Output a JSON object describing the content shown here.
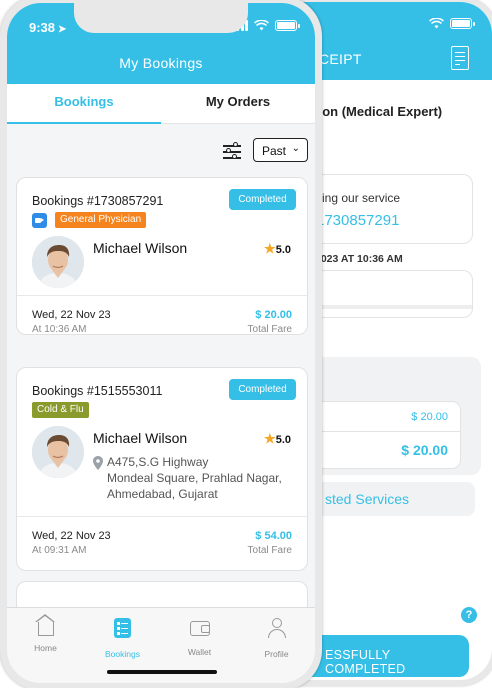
{
  "back_screen": {
    "title_fragment": "CEIPT",
    "doctor_fragment": "son (Medical Expert)",
    "thanks_fragment": "sing our service",
    "booking_id_fragment": "1730857291",
    "datetime_fragment": "2023 AT 10:36 AM",
    "amount_row": "$ 20.00",
    "amount_total": "$ 20.00",
    "services_fragment": "sted Services",
    "help_glyph": "?",
    "complete_fragment": "ESSFULLY COMPLETED"
  },
  "status_bar": {
    "time": "9:38",
    "nav_glyph": "➤"
  },
  "header": {
    "title": "My Bookings"
  },
  "tabs": [
    {
      "label": "Bookings",
      "active": true
    },
    {
      "label": "My Orders",
      "active": false
    }
  ],
  "filter": {
    "icon": "filter-sliders-icon",
    "selected": "Past",
    "chevron": "⌄"
  },
  "bookings": [
    {
      "id_label": "Bookings #1730857291",
      "status": "Completed",
      "consult_icon": "video-call-icon",
      "tag": "General Physician",
      "tag_color": "#f5841f",
      "doctor": "Michael Wilson",
      "rating": "5.0",
      "date": "Wed, 22 Nov 23",
      "time": "At 10:36 AM",
      "fare": "$ 20.00",
      "fare_label": "Total Fare"
    },
    {
      "id_label": "Bookings #1515553011",
      "status": "Completed",
      "tag": "Cold & Flu",
      "tag_color": "#8a9a2b",
      "doctor": "Michael Wilson",
      "rating": "5.0",
      "address_lines": [
        "A475,S.G Highway",
        "Mondeal Square, Prahlad Nagar,",
        "Ahmedabad, Gujarat"
      ],
      "date": "Wed, 22 Nov 23",
      "time": "At 09:31 AM",
      "fare": "$ 54.00",
      "fare_label": "Total Fare"
    }
  ],
  "bottom_nav": [
    {
      "label": "Home",
      "icon": "home-icon",
      "active": false
    },
    {
      "label": "Bookings",
      "icon": "bookings-icon",
      "active": true
    },
    {
      "label": "Wallet",
      "icon": "wallet-icon",
      "active": false
    },
    {
      "label": "Profile",
      "icon": "profile-icon",
      "active": false
    }
  ],
  "colors": {
    "accent": "#35bfe6",
    "star": "#f5a623",
    "video": "#2e8be6"
  }
}
